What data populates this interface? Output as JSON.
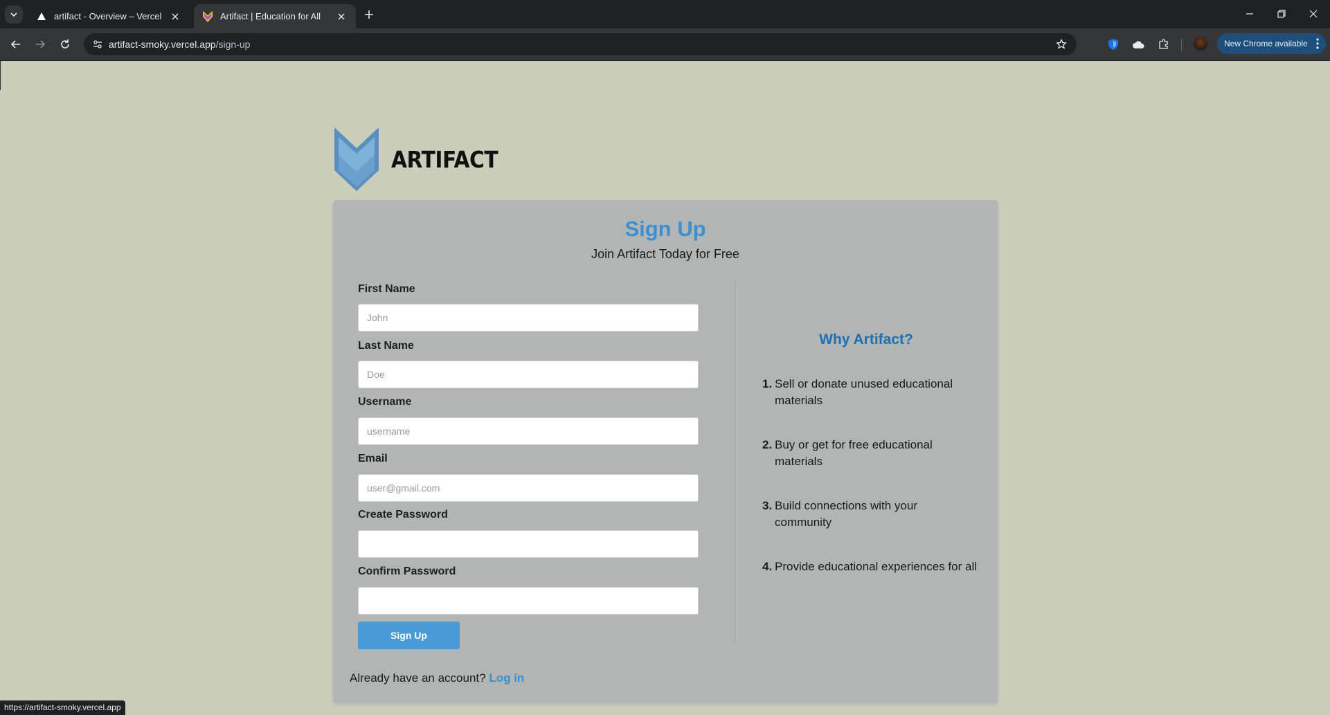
{
  "browser": {
    "tabs": [
      {
        "title": "artifact - Overview – Vercel",
        "favicon": "vercel-triangle-icon",
        "active": false
      },
      {
        "title": "Artifact | Education for All",
        "favicon": "artifact-logo-icon",
        "active": true
      }
    ],
    "url_host": "artifact-smoky.vercel.app",
    "url_path": "/sign-up",
    "update_label": "New Chrome available",
    "status_url": "https://artifact-smoky.vercel.app"
  },
  "brand": {
    "name": "ARTIFACT",
    "logo_colors": [
      "#5a8fbf",
      "#7fb2d9"
    ]
  },
  "signup": {
    "title": "Sign Up",
    "subtitle": "Join Artifact Today for Free",
    "fields": [
      {
        "label": "First Name",
        "placeholder": "John",
        "type": "text"
      },
      {
        "label": "Last Name",
        "placeholder": "Doe",
        "type": "text"
      },
      {
        "label": "Username",
        "placeholder": "username",
        "type": "text"
      },
      {
        "label": "Email",
        "placeholder": "user@gmail.com",
        "type": "email"
      },
      {
        "label": "Create Password",
        "placeholder": "",
        "type": "password"
      },
      {
        "label": "Confirm Password",
        "placeholder": "",
        "type": "password"
      }
    ],
    "submit_label": "Sign Up",
    "login_prompt": "Already have an account?",
    "login_link": "Log in"
  },
  "why": {
    "title": "Why Artifact?",
    "items": [
      {
        "num": "1.",
        "text": "Sell or donate unused educational materials"
      },
      {
        "num": "2.",
        "text": "Buy or get for free educational materials"
      },
      {
        "num": "3.",
        "text": "Build connections with your community"
      },
      {
        "num": "4.",
        "text": "Provide educational experiences for all"
      }
    ]
  },
  "colors": {
    "page_bg": "#cbcdbb",
    "card_bg": "#b1b5b3",
    "accent": "#3d8fd0",
    "accent_dark": "#1f6fb5"
  }
}
